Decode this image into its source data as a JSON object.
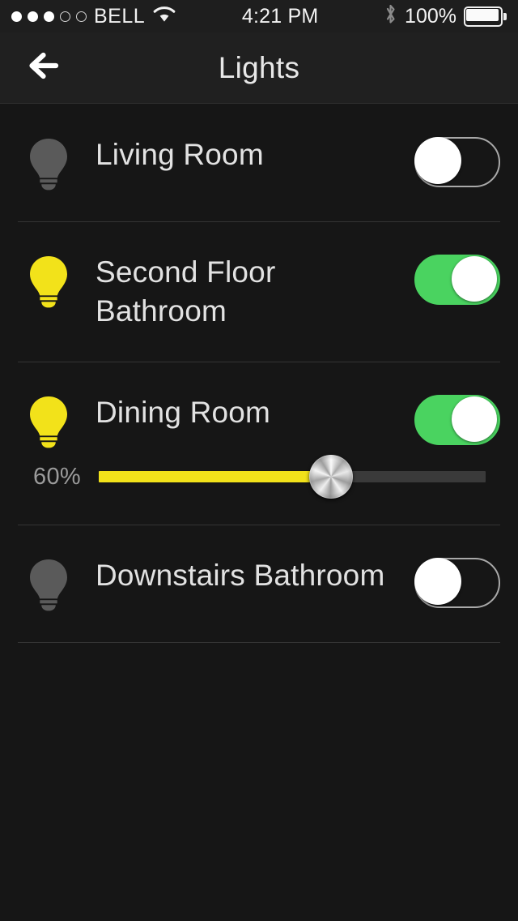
{
  "statusbar": {
    "signal_dots_filled": 3,
    "signal_dots_total": 5,
    "carrier": "BELL",
    "wifi_icon": "wifi-icon",
    "time": "4:21 PM",
    "bluetooth_icon": "bluetooth-icon",
    "battery_percent": "100%",
    "battery_level": 100
  },
  "navbar": {
    "back_icon": "back-arrow-icon",
    "title": "Lights"
  },
  "colors": {
    "toggle_on": "#4ad360",
    "bulb_on": "#f2e21a",
    "bulb_off": "#5a5a5a",
    "slider_fill": "#f2e21a",
    "slider_track": "#3a3a3a",
    "background": "#161616",
    "navbar_background": "#202020"
  },
  "lights": [
    {
      "name": "Living Room",
      "state": "off",
      "bulb_icon": "lightbulb-icon",
      "toggle_label": "Living Room toggle",
      "has_slider": false
    },
    {
      "name": "Second Floor Bathroom",
      "state": "on",
      "bulb_icon": "lightbulb-icon",
      "toggle_label": "Second Floor Bathroom toggle",
      "has_slider": false
    },
    {
      "name": "Dining Room",
      "state": "on",
      "bulb_icon": "lightbulb-icon",
      "toggle_label": "Dining Room toggle",
      "has_slider": true,
      "brightness_label": "60%",
      "brightness": 60
    },
    {
      "name": "Downstairs Bathroom",
      "state": "off",
      "bulb_icon": "lightbulb-icon",
      "toggle_label": "Downstairs Bathroom toggle",
      "has_slider": false
    }
  ]
}
